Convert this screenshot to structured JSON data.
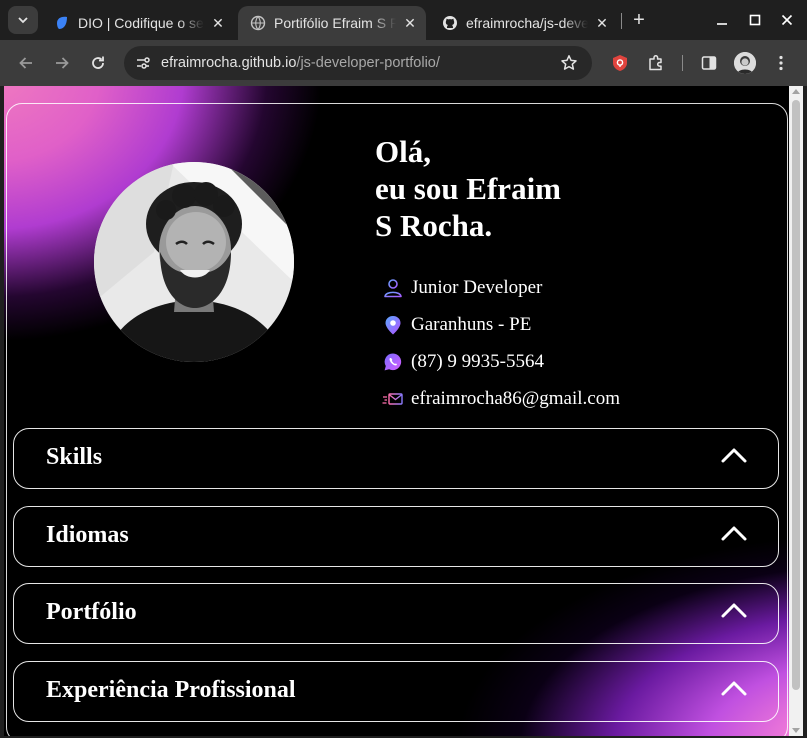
{
  "browser": {
    "tabs": [
      {
        "title": "DIO | Codifique o seu futuro global agora",
        "favicon": "dio-icon",
        "active": false
      },
      {
        "title": "Portifólio Efraim S Rocha",
        "favicon": "globe-icon",
        "active": true
      },
      {
        "title": "efraimrocha/js-developer-portfolio",
        "favicon": "github-icon",
        "active": false
      }
    ],
    "url_host": "efraimrocha.github.io",
    "url_path": "/js-developer-portfolio/"
  },
  "profile": {
    "greeting_line1": "Olá,",
    "greeting_line2": "eu sou Efraim",
    "greeting_line3": "S Rocha.",
    "info": [
      {
        "icon": "person-icon",
        "text": "Junior Developer"
      },
      {
        "icon": "location-pin-icon",
        "text": "Garanhuns - PE"
      },
      {
        "icon": "whatsapp-icon",
        "text": "(87) 9 9935-5564"
      },
      {
        "icon": "email-icon",
        "text": "efraimrocha86@gmail.com"
      }
    ]
  },
  "sections": [
    {
      "title": "Skills",
      "expanded": true
    },
    {
      "title": "Idiomas",
      "expanded": true
    },
    {
      "title": "Portfólio",
      "expanded": true
    },
    {
      "title": "Experiência Profissional",
      "expanded": true
    }
  ],
  "colors": {
    "accent_pink": "#f07ac0",
    "accent_purple": "#b03cd0",
    "page_background": "#000000",
    "browser_chrome": "#3c3c3c"
  }
}
